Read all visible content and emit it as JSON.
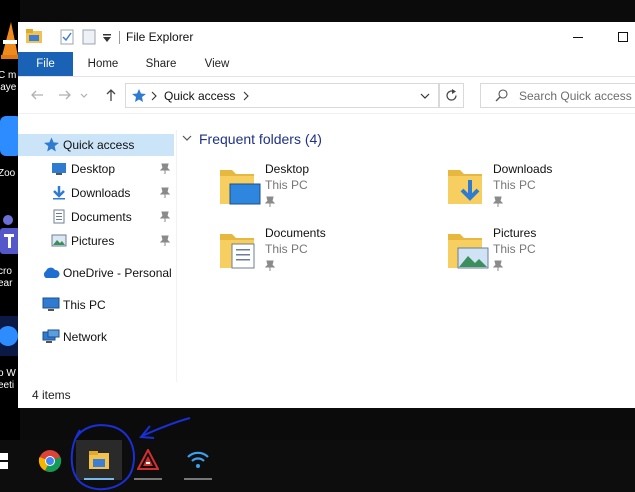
{
  "desktop": {
    "items": [
      {
        "label": "C m",
        "label2": "laye",
        "icon": "vlc-icon"
      },
      {
        "label": "Zoo",
        "icon": "zoom-icon"
      },
      {
        "label": "cro",
        "label2": "ear",
        "icon": "teams-icon"
      },
      {
        "label": "o W",
        "label2": "eeti",
        "icon": "zoom-workplace-icon"
      }
    ]
  },
  "window": {
    "title": "File Explorer",
    "ribbon_tabs": [
      "File",
      "Home",
      "Share",
      "View"
    ],
    "address": {
      "location": "Quick access"
    },
    "search": {
      "placeholder": "Search Quick access"
    },
    "nav": {
      "quick_access": "Quick access",
      "pinned": [
        {
          "label": "Desktop",
          "icon": "desktop-icon"
        },
        {
          "label": "Downloads",
          "icon": "downloads-icon"
        },
        {
          "label": "Documents",
          "icon": "documents-icon"
        },
        {
          "label": "Pictures",
          "icon": "pictures-icon"
        }
      ],
      "onedrive": "OneDrive - Personal",
      "this_pc": "This PC",
      "network": "Network"
    },
    "content": {
      "group_title": "Frequent folders (4)",
      "folders": [
        {
          "name": "Desktop",
          "location": "This PC",
          "icon": "desktop-folder-icon"
        },
        {
          "name": "Downloads",
          "location": "This PC",
          "icon": "downloads-folder-icon"
        },
        {
          "name": "Documents",
          "location": "This PC",
          "icon": "documents-folder-icon"
        },
        {
          "name": "Pictures",
          "location": "This PC",
          "icon": "pictures-folder-icon"
        }
      ]
    },
    "status": "4 items"
  },
  "taskbar": {
    "items": [
      {
        "name": "start",
        "icon": "windows-logo-icon"
      },
      {
        "name": "chrome",
        "icon": "chrome-icon"
      },
      {
        "name": "file-explorer",
        "icon": "file-explorer-icon",
        "active": true
      },
      {
        "name": "app",
        "icon": "red-app-icon"
      },
      {
        "name": "wifi",
        "icon": "wifi-icon"
      }
    ]
  },
  "colors": {
    "accent": "#1a62b5",
    "selection": "#cce4f7",
    "group_heading": "#1e3287",
    "annotation": "#1a2fd6"
  }
}
